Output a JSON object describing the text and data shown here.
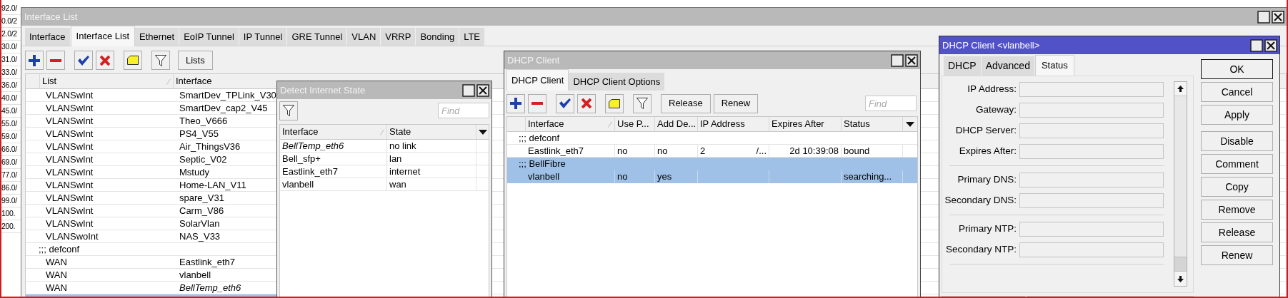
{
  "background_list": {
    "cells": [
      "92.0/",
      "0.0/2",
      "2.0/2",
      "30.0/",
      "31.0/",
      "33.0/",
      "36.0/",
      "40.0/",
      "45.0/",
      "55.0/",
      "59.0/",
      "66.0/",
      "69.0/",
      "77.0/",
      "86.0/",
      "99.0/",
      "100.",
      "200."
    ]
  },
  "interface_list": {
    "title": "Interface List",
    "tabs": [
      {
        "label": "Interface",
        "selected": false
      },
      {
        "label": "Interface List",
        "selected": true
      },
      {
        "label": "Ethernet",
        "selected": false
      },
      {
        "label": "EoIP Tunnel",
        "selected": false
      },
      {
        "label": "IP Tunnel",
        "selected": false
      },
      {
        "label": "GRE Tunnel",
        "selected": false
      },
      {
        "label": "VLAN",
        "selected": false
      },
      {
        "label": "VRRP",
        "selected": false
      },
      {
        "label": "Bonding",
        "selected": false
      },
      {
        "label": "LTE",
        "selected": false
      }
    ],
    "lists_button": "Lists",
    "columns": [
      "List",
      "Interface"
    ],
    "rows": [
      {
        "kind": "item",
        "list": "VLANSwInt",
        "interface": "SmartDev_TPLink_V30",
        "inactive": false,
        "selected": false
      },
      {
        "kind": "item",
        "list": "VLANSwInt",
        "interface": "SmartDev_cap2_V45",
        "inactive": false,
        "selected": false
      },
      {
        "kind": "item",
        "list": "VLANSwInt",
        "interface": "Theo_V666",
        "inactive": false,
        "selected": false
      },
      {
        "kind": "item",
        "list": "VLANSwInt",
        "interface": "PS4_V55",
        "inactive": false,
        "selected": false
      },
      {
        "kind": "item",
        "list": "VLANSwInt",
        "interface": "Air_ThingsV36",
        "inactive": false,
        "selected": false
      },
      {
        "kind": "item",
        "list": "VLANSwInt",
        "interface": "Septic_V02",
        "inactive": false,
        "selected": false
      },
      {
        "kind": "item",
        "list": "VLANSwInt",
        "interface": "Mstudy",
        "inactive": false,
        "selected": false
      },
      {
        "kind": "item",
        "list": "VLANSwInt",
        "interface": "Home-LAN_V11",
        "inactive": false,
        "selected": false
      },
      {
        "kind": "item",
        "list": "VLANSwInt",
        "interface": "spare_V31",
        "inactive": false,
        "selected": false
      },
      {
        "kind": "item",
        "list": "VLANSwInt",
        "interface": "Carm_V86",
        "inactive": false,
        "selected": false
      },
      {
        "kind": "item",
        "list": "VLANSwInt",
        "interface": "SolarVlan",
        "inactive": false,
        "selected": false
      },
      {
        "kind": "item",
        "list": "VLANSwoInt",
        "interface": "NAS_V33",
        "inactive": false,
        "selected": false
      },
      {
        "kind": "comment",
        "text": ";;; defconf",
        "selected": false
      },
      {
        "kind": "item",
        "list": "WAN",
        "interface": "Eastlink_eth7",
        "inactive": false,
        "selected": false
      },
      {
        "kind": "item",
        "list": "WAN",
        "interface": "vlanbell",
        "inactive": false,
        "selected": false
      },
      {
        "kind": "item",
        "list": "WAN",
        "interface": "BellTemp_eth6",
        "inactive": true,
        "selected": false
      },
      {
        "kind": "blank",
        "selected": true
      }
    ]
  },
  "detect_internet_state": {
    "title": "Detect Internet State",
    "find_placeholder": "Find",
    "columns": [
      "Interface",
      "State"
    ],
    "rows": [
      {
        "interface": "BellTemp_eth6",
        "state": "no link",
        "inactive": true
      },
      {
        "interface": "Bell_sfp+",
        "state": "lan",
        "inactive": false
      },
      {
        "interface": "Eastlink_eth7",
        "state": "internet",
        "inactive": false
      },
      {
        "interface": "vlanbell",
        "state": "wan",
        "inactive": false
      }
    ]
  },
  "dhcp_client": {
    "title": "DHCP Client",
    "tabs": [
      {
        "label": "DHCP Client",
        "selected": true
      },
      {
        "label": "DHCP Client Options",
        "selected": false
      }
    ],
    "buttons": [
      "Release",
      "Renew"
    ],
    "find_placeholder": "Find",
    "columns": [
      "Interface",
      "Use P...",
      "Add De...",
      "IP Address",
      "Expires After",
      "Status"
    ],
    "rows": [
      {
        "kind": "comment",
        "text": ";;; defconf",
        "selected": false
      },
      {
        "kind": "item",
        "interface": "Eastlink_eth7",
        "use_peer_dns": "no",
        "add_default_route": "no",
        "ip_address": "2",
        "ip_address_tail": "/...",
        "expires_after": "2d 10:39:08",
        "status": "bound",
        "selected": false
      },
      {
        "kind": "comment",
        "text": ";;; BellFibre",
        "selected": true
      },
      {
        "kind": "item",
        "interface": "vlanbell",
        "use_peer_dns": "no",
        "add_default_route": "yes",
        "status": "searching...",
        "selected": true
      }
    ]
  },
  "dhcp_client_vlanbell": {
    "title": "DHCP Client <vlanbell>",
    "tabs": [
      {
        "label": "DHCP",
        "selected": false
      },
      {
        "label": "Advanced",
        "selected": false
      },
      {
        "label": "Status",
        "selected": true
      }
    ],
    "field_groups": [
      [
        "IP Address:",
        "Gateway:",
        "DHCP Server:",
        "Expires After:"
      ],
      [
        "Primary DNS:",
        "Secondary DNS:"
      ],
      [
        "Primary NTP:",
        "Secondary NTP:"
      ]
    ],
    "button_groups": [
      [
        {
          "label": "OK",
          "default": true
        },
        {
          "label": "Cancel",
          "default": false
        },
        {
          "label": "Apply",
          "default": false
        }
      ],
      [
        {
          "label": "Disable",
          "default": false
        },
        {
          "label": "Comment",
          "default": false
        },
        {
          "label": "Copy",
          "default": false
        },
        {
          "label": "Remove",
          "default": false
        },
        {
          "label": "Release",
          "default": false
        },
        {
          "label": "Renew",
          "default": false
        }
      ]
    ]
  }
}
